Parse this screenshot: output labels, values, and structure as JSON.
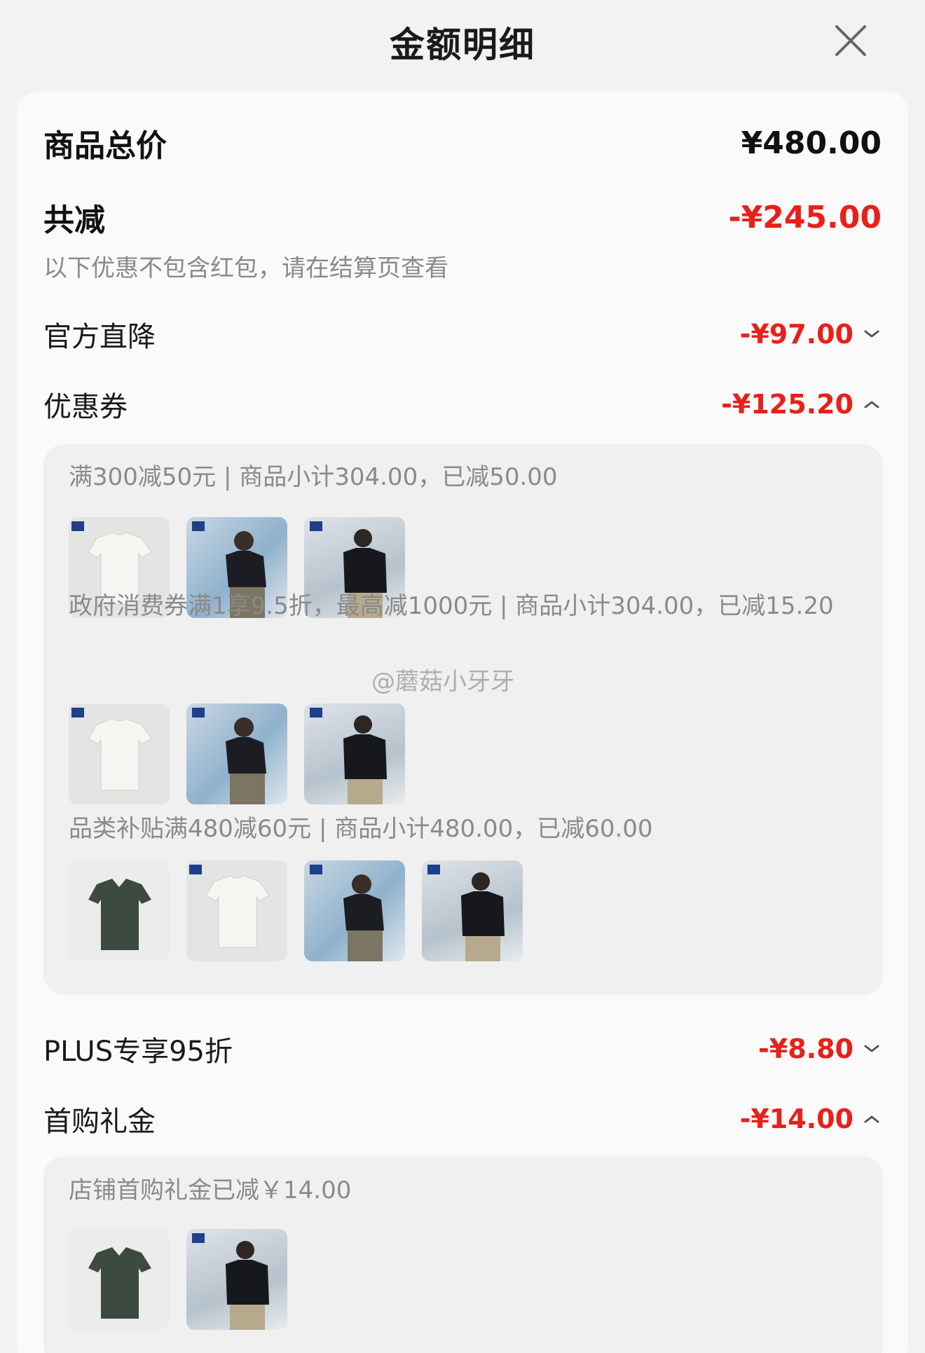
{
  "header": {
    "title": "金额明细"
  },
  "total": {
    "label": "商品总价",
    "amount": "¥480.00"
  },
  "discount": {
    "label": "共减",
    "amount": "-¥245.00",
    "note": "以下优惠不包含红包，请在结算页查看"
  },
  "items": {
    "official": {
      "label": "官方直降",
      "amount": "-¥97.00",
      "state": "collapsed"
    },
    "coupon": {
      "label": "优惠券",
      "amount": "-¥125.20",
      "state": "expanded"
    },
    "plus": {
      "label": "PLUS专享95折",
      "amount": "-¥8.80",
      "state": "collapsed"
    },
    "firstbuy": {
      "label": "首购礼金",
      "amount": "-¥14.00",
      "state": "expanded"
    }
  },
  "coupon_details": [
    {
      "text": "满300减50元 | 商品小计304.00，已减50.00",
      "thumbs": [
        "white-tee",
        "navy-tee-model",
        "navy-polo-model"
      ]
    },
    {
      "text": "政府消费券满1享9.5折，最高减1000元 | 商品小计304.00，已减15.20",
      "thumbs": [
        "white-tee",
        "navy-tee-model",
        "navy-polo-model"
      ]
    },
    {
      "text": "品类补贴满480减60元 | 商品小计480.00，已减60.00",
      "thumbs": [
        "green-polo",
        "white-tee",
        "navy-tee-model",
        "navy-polo-model"
      ]
    }
  ],
  "firstbuy_detail": {
    "text": "店铺首购礼金已减￥14.00",
    "thumbs": [
      "green-polo",
      "navy-polo-model"
    ]
  },
  "watermark": "@蘑菇小牙牙",
  "colors": {
    "accent_red": "#e8201a",
    "muted_text": "#8a8a8a"
  }
}
